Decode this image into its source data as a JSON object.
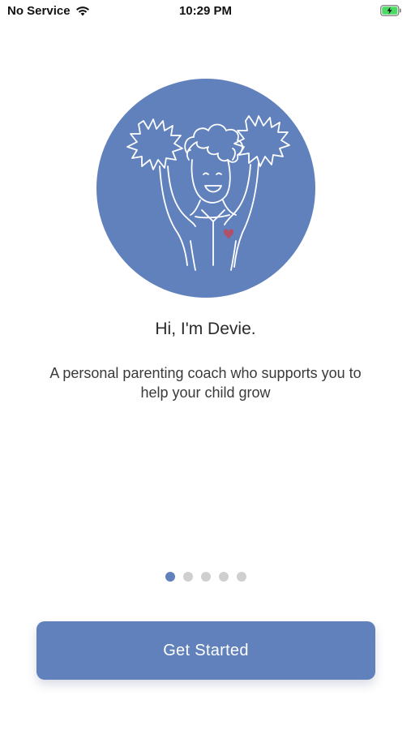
{
  "status_bar": {
    "carrier": "No Service",
    "time": "10:29 PM",
    "wifi_icon": "wifi-icon",
    "battery_icon": "battery-charging-icon"
  },
  "hero": {
    "icon": "cheerleader-illustration",
    "circle_color": "#6181bd"
  },
  "onboarding": {
    "title": "Hi, I'm Devie.",
    "description": "A personal parenting coach who supports you to help your child grow"
  },
  "pagination": {
    "current_page": 1,
    "total_pages": 5,
    "active_color": "#6181bd",
    "inactive_color": "#cfcfcf"
  },
  "cta": {
    "label": "Get Started",
    "color": "#6181bd"
  }
}
